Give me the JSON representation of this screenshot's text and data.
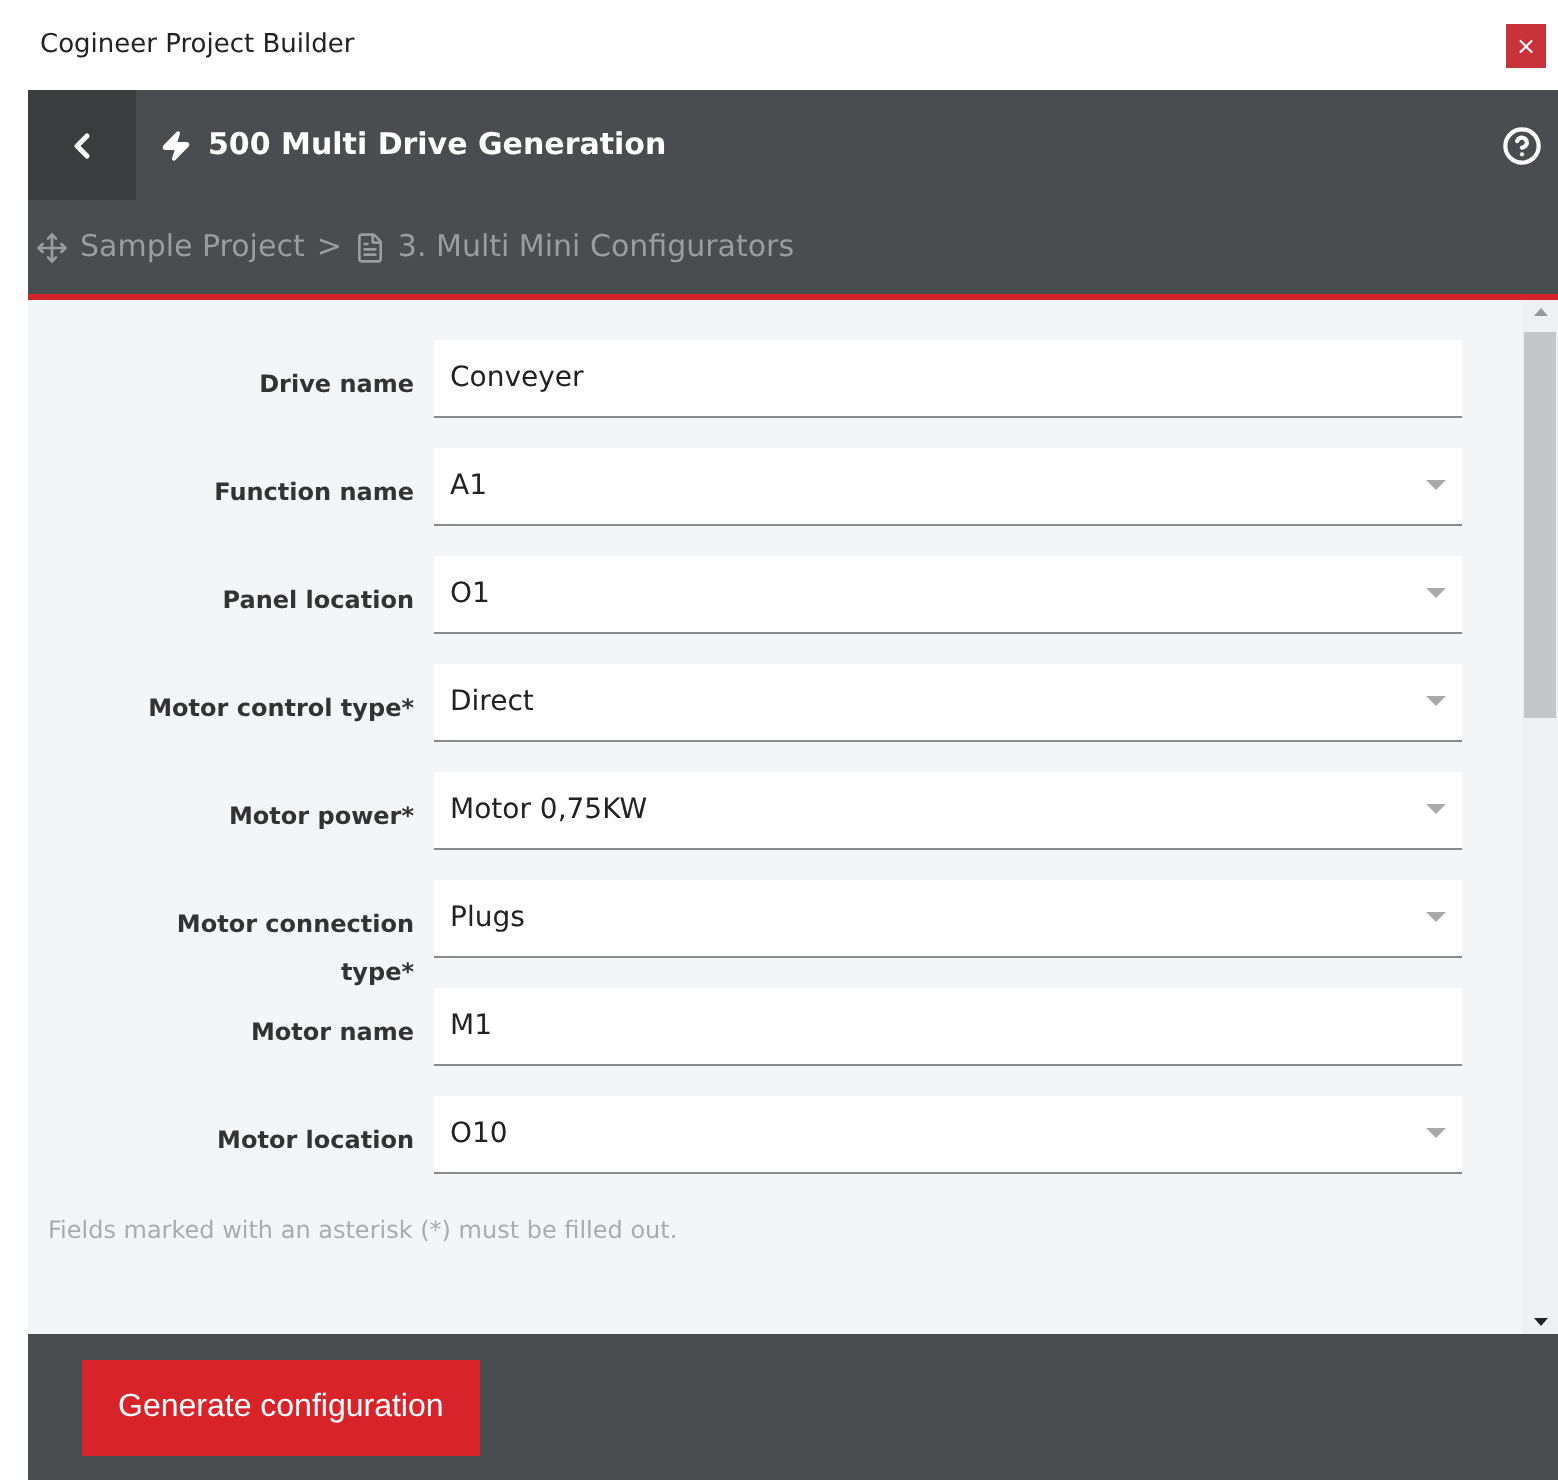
{
  "window": {
    "title": "Cogineer Project Builder",
    "close": "×"
  },
  "header": {
    "title": "500 Multi Drive Generation"
  },
  "breadcrumb": [
    {
      "label": "Sample Project"
    },
    {
      "label": "3. Multi Mini Configurators"
    }
  ],
  "breadcrumb_separator": ">",
  "fields": [
    {
      "label": "Drive name",
      "value": "Conveyer",
      "kind": "text"
    },
    {
      "label": "Function name",
      "value": "A1",
      "kind": "select"
    },
    {
      "label": "Panel location",
      "value": "O1",
      "kind": "select"
    },
    {
      "label": "Motor control type*",
      "value": "Direct",
      "kind": "select"
    },
    {
      "label": "Motor power*",
      "value": "Motor 0,75KW",
      "kind": "select"
    },
    {
      "label": "Motor connection type*",
      "value": "Plugs",
      "kind": "select"
    },
    {
      "label": "Motor name",
      "value": "M1",
      "kind": "text"
    },
    {
      "label": "Motor location",
      "value": "O10",
      "kind": "select"
    }
  ],
  "note": "Fields marked with an asterisk (*) must be filled out.",
  "button": "Generate configuration"
}
